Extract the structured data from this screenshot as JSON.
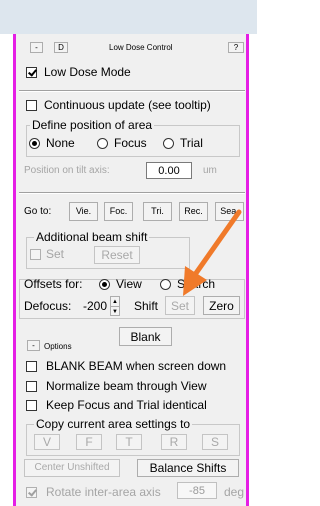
{
  "header": {
    "collapse_label": "-",
    "dock_label": "D",
    "title": "Low Dose Control",
    "help_label": "?"
  },
  "low_dose_mode": {
    "label": "Low Dose Mode",
    "checked": true
  },
  "continuous_update": {
    "label": "Continuous update (see tooltip)",
    "checked": false
  },
  "define_area": {
    "legend": "Define position of area",
    "options": [
      "None",
      "Focus",
      "Trial"
    ],
    "selected": "None"
  },
  "tilt_position": {
    "label": "Position on tilt axis:",
    "value": "0.00",
    "unit": "um"
  },
  "goto": {
    "label": "Go to:",
    "buttons": [
      "Vie.",
      "Foc.",
      "Tri.",
      "Rec.",
      "Sea."
    ]
  },
  "beam_shift": {
    "legend": "Additional beam shift",
    "set_label": "Set",
    "reset_label": "Reset"
  },
  "offsets": {
    "label": "Offsets for:",
    "options": [
      "View",
      "Search"
    ],
    "selected": "View"
  },
  "defocus": {
    "label": "Defocus:",
    "value": "-200",
    "shift_label": "Shift",
    "set_label": "Set",
    "zero_label": "Zero"
  },
  "options_section": {
    "collapse_label": "-",
    "label": "Options",
    "blank_label": "Blank",
    "checkboxes": [
      {
        "label": "BLANK BEAM when screen down",
        "checked": false
      },
      {
        "label": "Normalize beam through View",
        "checked": false
      },
      {
        "label": "Keep Focus and Trial identical",
        "checked": false
      }
    ]
  },
  "copy_settings": {
    "legend": "Copy current area settings to",
    "buttons": [
      "V",
      "F",
      "T",
      "R",
      "S"
    ]
  },
  "bottom": {
    "center_unshifted_label": "Center Unshifted",
    "balance_shifts_label": "Balance Shifts",
    "rotate_label": "Rotate inter-area axis",
    "rotate_checked": true,
    "rotate_value": "-85",
    "rotate_unit": "deg"
  },
  "colors": {
    "panel_border": "#e51ee5",
    "annotation_arrow": "#f07a2a",
    "top_bar": "#dde6ee"
  }
}
